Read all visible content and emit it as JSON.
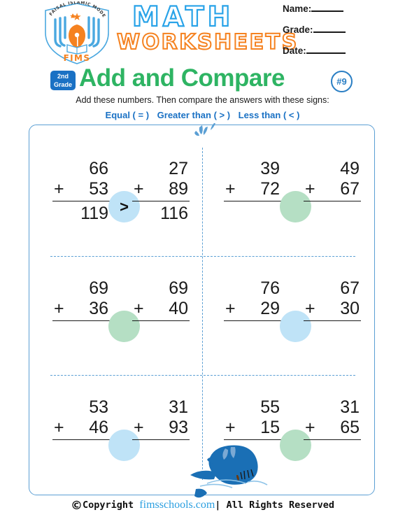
{
  "header": {
    "logo": {
      "school_name_arc": "FAISAL ISLAMIC MODEL SCHOOL",
      "acronym": "FIMS"
    },
    "title_word_1": "MATH",
    "title_word_2": "WORKSHEETS",
    "student_fields": [
      {
        "label": "Name:"
      },
      {
        "label": "Grade:"
      },
      {
        "label": "Date:"
      }
    ]
  },
  "subject": {
    "grade_badge_line1": "2nd",
    "grade_badge_line2": "Grade",
    "title": "Add and Compare",
    "sheet_number": "#9"
  },
  "instructions": {
    "main": "Add these numbers.  Then compare the answers with these signs:",
    "signs": [
      "Equal ( = )",
      "Greater than ( > )",
      "Less than ( < )"
    ]
  },
  "colors": {
    "frame_blue": "#5b9fd4",
    "title_green": "#2eb463",
    "math_blue": "#29a3e8",
    "worksheets_orange": "#f58220",
    "badge_blue": "#1a71c4",
    "circle_blue": "#bfe3f7",
    "circle_green": "#b5dfc4",
    "whale_blue": "#1a6fb5",
    "link_blue": "#2b9fe0"
  },
  "problems": [
    {
      "row": 1,
      "pairs": [
        {
          "left": {
            "top": "66",
            "operator": "+",
            "bottom": "53",
            "result": "119"
          },
          "right": {
            "top": "27",
            "operator": "+",
            "bottom": "89",
            "result": "116"
          },
          "circle": {
            "color": "#bfe3f7",
            "symbol": ">"
          }
        },
        {
          "left": {
            "top": "39",
            "operator": "+",
            "bottom": "72",
            "result": ""
          },
          "right": {
            "top": "49",
            "operator": "+",
            "bottom": "67",
            "result": ""
          },
          "circle": {
            "color": "#b5dfc4",
            "symbol": ""
          }
        }
      ]
    },
    {
      "row": 2,
      "pairs": [
        {
          "left": {
            "top": "69",
            "operator": "+",
            "bottom": "36",
            "result": ""
          },
          "right": {
            "top": "69",
            "operator": "+",
            "bottom": "40",
            "result": ""
          },
          "circle": {
            "color": "#b5dfc4",
            "symbol": ""
          }
        },
        {
          "left": {
            "top": "76",
            "operator": "+",
            "bottom": "29",
            "result": ""
          },
          "right": {
            "top": "67",
            "operator": "+",
            "bottom": "30",
            "result": ""
          },
          "circle": {
            "color": "#bfe3f7",
            "symbol": ""
          }
        }
      ]
    },
    {
      "row": 3,
      "pairs": [
        {
          "left": {
            "top": "53",
            "operator": "+",
            "bottom": "46",
            "result": ""
          },
          "right": {
            "top": "31",
            "operator": "+",
            "bottom": "93",
            "result": ""
          },
          "circle": {
            "color": "#bfe3f7",
            "symbol": ""
          }
        },
        {
          "left": {
            "top": "55",
            "operator": "+",
            "bottom": "15",
            "result": ""
          },
          "right": {
            "top": "31",
            "operator": "+",
            "bottom": "65",
            "result": ""
          },
          "circle": {
            "color": "#b5dfc4",
            "symbol": ""
          }
        }
      ]
    }
  ],
  "footer": {
    "copyright_symbol": "©",
    "copyright_text": "Copyright",
    "site": "fimsschools.com",
    "rights": "| All Rights Reserved"
  }
}
